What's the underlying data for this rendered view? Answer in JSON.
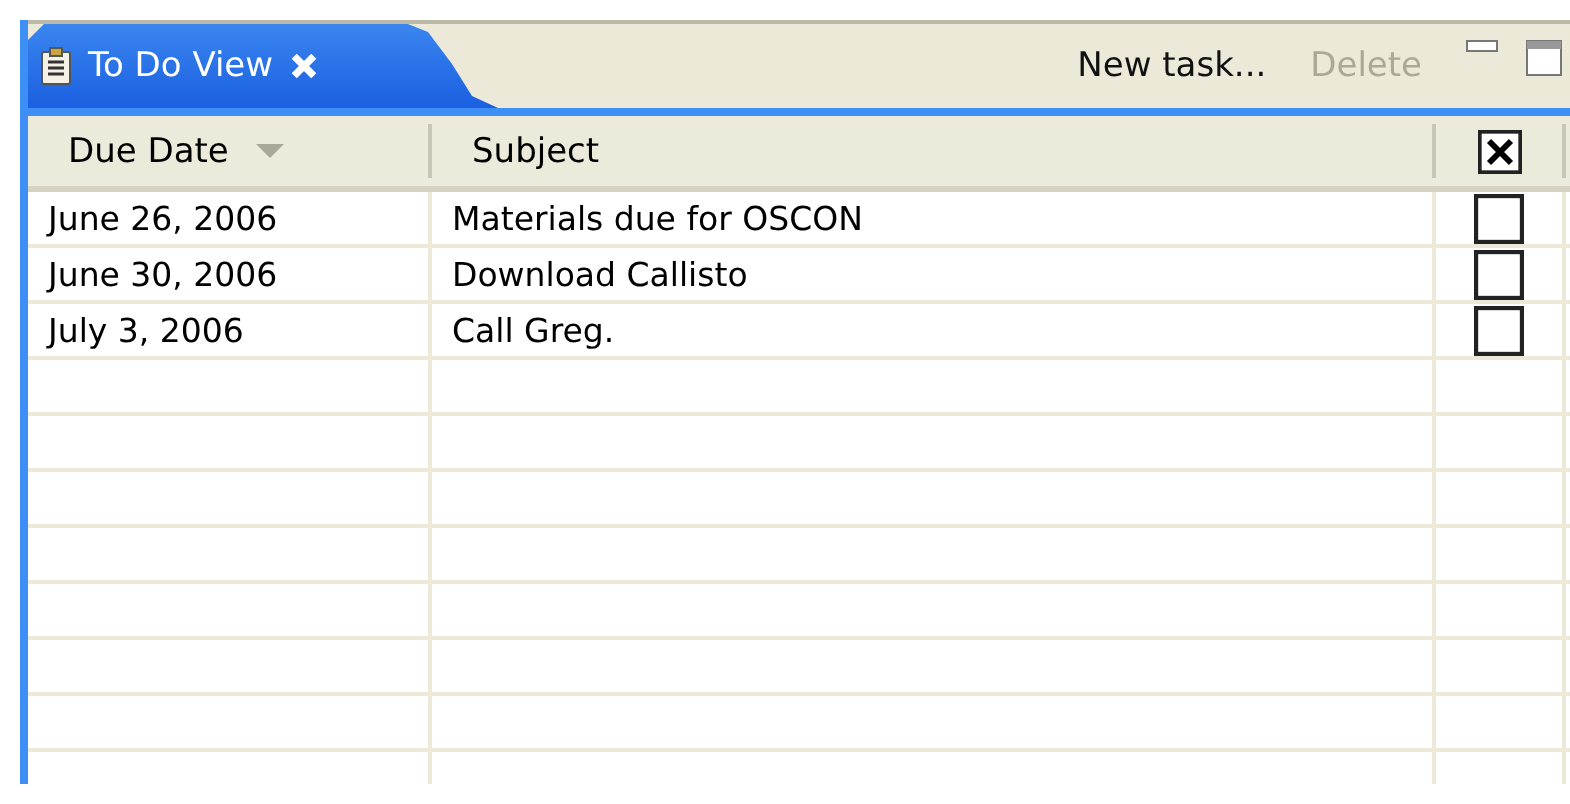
{
  "view": {
    "title": "To Do View",
    "actions": [
      {
        "label": "New task...",
        "disabled": false
      },
      {
        "label": "Delete",
        "disabled": true
      }
    ]
  },
  "table": {
    "columns": [
      {
        "kind": "text",
        "label": "Due Date",
        "sorted": true
      },
      {
        "kind": "text",
        "label": "Subject",
        "sorted": false
      },
      {
        "kind": "check",
        "checked": true
      }
    ],
    "rows": [
      {
        "due": "June 26, 2006",
        "subject": "Materials due for OSCON",
        "done": false
      },
      {
        "due": "June 30, 2006",
        "subject": "Download Callisto",
        "done": false
      },
      {
        "due": "July 3, 2006",
        "subject": "Call Greg.",
        "done": false
      }
    ]
  }
}
